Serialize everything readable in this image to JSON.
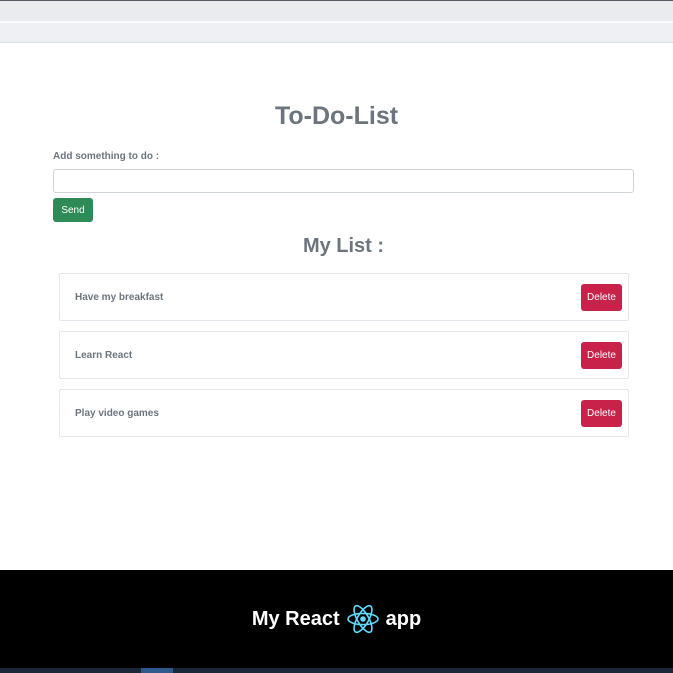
{
  "app": {
    "title": "To-Do-List",
    "add_label": "Add something to do :",
    "input_value": "",
    "input_placeholder": "",
    "send_label": "Send",
    "list_title": "My List :"
  },
  "todos": [
    {
      "text": "Have my breakfast",
      "delete_label": "Delete"
    },
    {
      "text": "Learn React",
      "delete_label": "Delete"
    },
    {
      "text": "Play video games",
      "delete_label": "Delete"
    }
  ],
  "footer": {
    "text_before": "My React",
    "logo_icon": "react-logo-icon",
    "text_after": "app"
  },
  "colors": {
    "send": "#2e8b57",
    "delete": "#c8214a",
    "footer_bg": "#000000",
    "react_logo": "#61dafb",
    "text_muted": "#6c757d"
  }
}
